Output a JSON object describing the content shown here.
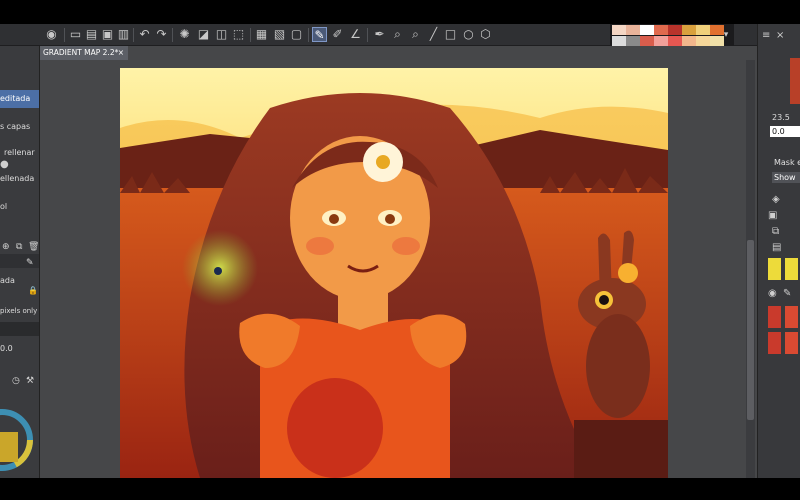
{
  "document": {
    "tab_title": "GRADIENT MAP 2.2*",
    "close_glyph": "×"
  },
  "left_panel": {
    "items": [
      {
        "label": "editada",
        "selected": true
      },
      {
        "label": "s capas"
      },
      {
        "label": "rellenar"
      },
      {
        "label": "ellenada"
      },
      {
        "label": "ol"
      },
      {
        "label": "ada"
      },
      {
        "label": "pixels only"
      },
      {
        "label": "0.0"
      }
    ]
  },
  "right_panel": {
    "value_1": "23.5",
    "value_2": "0.0",
    "mask_label": "Mask e",
    "show_label": "Show"
  },
  "colors": {
    "ui_dark": "#2f3033",
    "accent_selected": "#4c6fa6",
    "toolbar_active": "#4b5a78"
  },
  "icons": [
    "menu-icon",
    "new-file-icon",
    "open-folder-icon",
    "save-icon",
    "undo-icon",
    "redo-icon",
    "spinner-icon",
    "fill-icon",
    "transform-icon",
    "ruler-icon",
    "select-brush-icon",
    "layer-icon",
    "pen-icon",
    "eyedropper-icon",
    "zoom-icon",
    "line-icon",
    "rectangle-icon",
    "ellipse-icon",
    "polygon-icon"
  ]
}
